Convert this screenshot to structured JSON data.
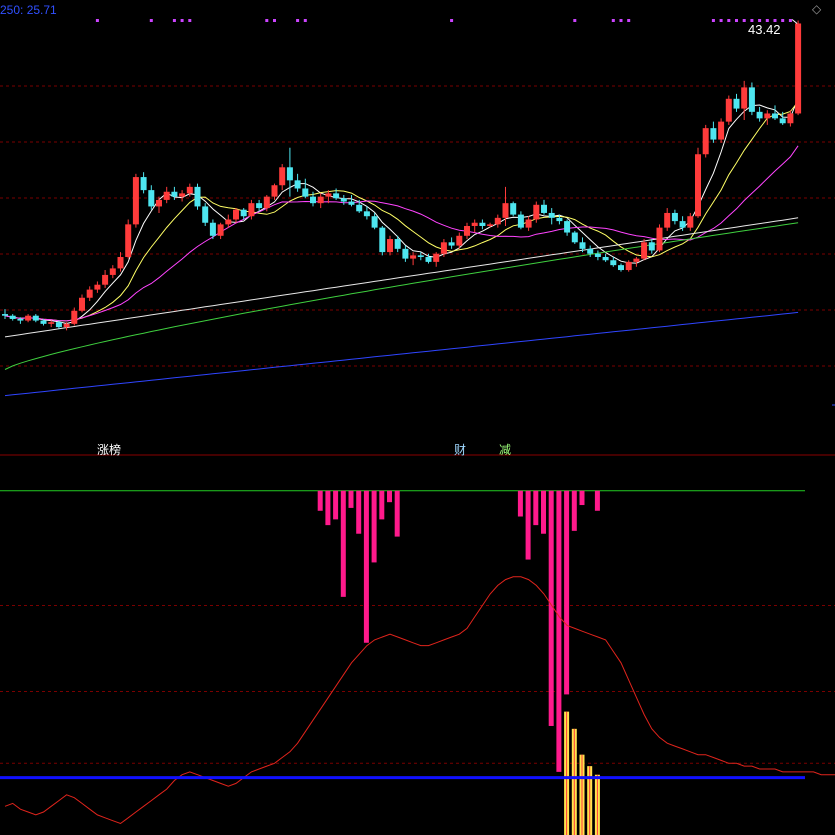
{
  "header": {
    "ma_label": "250: 25.71",
    "last_price": "43.42"
  },
  "signals": {
    "zhangbang": "涨榜",
    "cai": "财",
    "jian": "减"
  },
  "colors": {
    "background": "#000000",
    "up": "#ff3b3b",
    "down": "#4ee6f0",
    "grid": "#7a0000",
    "ma5": "#ffffff",
    "ma10": "#ffff66",
    "ma20": "#ff44ff",
    "ma60": "#3fcf3f",
    "ma120": "#e8e8e8",
    "ma250": "#2f45ff",
    "hist_pink": "#ff1a8c",
    "hist_yellow": "#ffe24d",
    "indicator_line": "#e0241c",
    "zero_line": "#1010ff",
    "upper_line": "#22cc22",
    "markers": "#cc44ff"
  },
  "chart_data": [
    {
      "type": "candlestick",
      "title": "",
      "price_range": [
        18,
        44
      ],
      "last_price": 43.42,
      "bars": [
        [
          25.6,
          25.9,
          25.3,
          25.5
        ],
        [
          25.5,
          25.6,
          25.2,
          25.3
        ],
        [
          25.3,
          25.4,
          25.0,
          25.2
        ],
        [
          25.2,
          25.6,
          25.1,
          25.5
        ],
        [
          25.5,
          25.6,
          25.1,
          25.2
        ],
        [
          25.2,
          25.3,
          24.9,
          25.0
        ],
        [
          25.0,
          25.2,
          24.8,
          25.1
        ],
        [
          25.1,
          25.2,
          24.7,
          24.8
        ],
        [
          24.8,
          25.1,
          24.6,
          25.0
        ],
        [
          25.0,
          26.0,
          24.9,
          25.8
        ],
        [
          25.8,
          26.8,
          25.7,
          26.6
        ],
        [
          26.6,
          27.3,
          26.4,
          27.1
        ],
        [
          27.1,
          27.6,
          26.9,
          27.4
        ],
        [
          27.4,
          28.3,
          27.2,
          28.0
        ],
        [
          28.0,
          28.6,
          27.8,
          28.4
        ],
        [
          28.4,
          29.4,
          28.2,
          29.1
        ],
        [
          29.1,
          31.4,
          29.0,
          31.1
        ],
        [
          31.1,
          34.2,
          30.9,
          34.0
        ],
        [
          34.0,
          34.3,
          33.0,
          33.2
        ],
        [
          33.2,
          33.5,
          32.0,
          32.2
        ],
        [
          32.2,
          32.8,
          31.8,
          32.6
        ],
        [
          32.6,
          33.4,
          32.4,
          33.1
        ],
        [
          33.1,
          33.4,
          32.6,
          32.8
        ],
        [
          32.8,
          33.2,
          32.5,
          33.0
        ],
        [
          33.0,
          33.6,
          32.8,
          33.4
        ],
        [
          33.4,
          33.6,
          32.0,
          32.2
        ],
        [
          32.2,
          32.4,
          31.0,
          31.2
        ],
        [
          31.2,
          31.4,
          30.2,
          30.4
        ],
        [
          30.4,
          31.2,
          30.2,
          31.1
        ],
        [
          31.1,
          31.7,
          30.9,
          31.4
        ],
        [
          31.4,
          32.1,
          31.2,
          32.0
        ],
        [
          32.0,
          32.1,
          31.4,
          31.6
        ],
        [
          31.6,
          32.6,
          31.4,
          32.4
        ],
        [
          32.4,
          32.6,
          31.9,
          32.1
        ],
        [
          32.1,
          32.9,
          31.9,
          32.8
        ],
        [
          32.8,
          33.6,
          32.6,
          33.5
        ],
        [
          33.5,
          34.8,
          33.2,
          34.6
        ],
        [
          34.6,
          35.8,
          32.8,
          33.8
        ],
        [
          33.8,
          34.2,
          33.1,
          33.3
        ],
        [
          33.3,
          33.9,
          32.7,
          32.8
        ],
        [
          32.8,
          33.1,
          32.2,
          32.4
        ],
        [
          32.4,
          33.0,
          32.1,
          32.8
        ],
        [
          32.8,
          33.2,
          32.4,
          33.0
        ],
        [
          33.0,
          33.3,
          32.6,
          32.7
        ],
        [
          32.7,
          32.9,
          32.3,
          32.5
        ],
        [
          32.5,
          32.9,
          32.2,
          32.3
        ],
        [
          32.3,
          32.6,
          31.8,
          31.9
        ],
        [
          31.9,
          32.2,
          31.4,
          31.6
        ],
        [
          31.6,
          31.8,
          30.8,
          30.9
        ],
        [
          30.9,
          31.0,
          29.2,
          29.4
        ],
        [
          29.4,
          30.4,
          29.2,
          30.2
        ],
        [
          30.2,
          30.4,
          29.4,
          29.6
        ],
        [
          29.6,
          29.8,
          28.8,
          29.0
        ],
        [
          29.0,
          29.4,
          28.6,
          29.2
        ],
        [
          29.2,
          29.4,
          28.9,
          29.1
        ],
        [
          29.1,
          29.3,
          28.7,
          28.8
        ],
        [
          28.8,
          29.4,
          28.5,
          29.3
        ],
        [
          29.3,
          30.2,
          29.1,
          30.0
        ],
        [
          30.0,
          30.3,
          29.6,
          29.8
        ],
        [
          29.8,
          30.6,
          29.6,
          30.4
        ],
        [
          30.4,
          31.2,
          30.2,
          31.0
        ],
        [
          31.0,
          31.4,
          30.6,
          31.2
        ],
        [
          31.2,
          31.4,
          30.8,
          31.0
        ],
        [
          31.0,
          31.2,
          30.9,
          31.1
        ],
        [
          31.1,
          31.7,
          30.9,
          31.5
        ],
        [
          31.5,
          33.4,
          31.0,
          32.4
        ],
        [
          32.4,
          32.5,
          31.6,
          31.7
        ],
        [
          31.7,
          31.9,
          30.8,
          30.9
        ],
        [
          30.9,
          31.6,
          30.7,
          31.4
        ],
        [
          31.4,
          32.5,
          31.2,
          32.3
        ],
        [
          32.3,
          32.6,
          31.7,
          31.8
        ],
        [
          31.8,
          32.1,
          31.1,
          31.5
        ],
        [
          31.5,
          31.7,
          31.1,
          31.3
        ],
        [
          31.3,
          31.4,
          30.4,
          30.6
        ],
        [
          30.6,
          30.7,
          29.9,
          30.0
        ],
        [
          30.0,
          30.3,
          29.4,
          29.6
        ],
        [
          29.6,
          29.8,
          29.1,
          29.3
        ],
        [
          29.3,
          29.5,
          28.9,
          29.1
        ],
        [
          29.1,
          29.3,
          28.8,
          28.9
        ],
        [
          28.9,
          29.1,
          28.5,
          28.6
        ],
        [
          28.6,
          28.7,
          28.2,
          28.3
        ],
        [
          28.3,
          28.9,
          28.2,
          28.8
        ],
        [
          28.8,
          29.1,
          28.5,
          29.0
        ],
        [
          29.0,
          30.2,
          28.9,
          30.0
        ],
        [
          30.0,
          30.2,
          29.3,
          29.5
        ],
        [
          29.5,
          31.1,
          29.4,
          30.9
        ],
        [
          30.9,
          32.1,
          30.7,
          31.8
        ],
        [
          31.8,
          32.0,
          31.1,
          31.3
        ],
        [
          31.3,
          31.6,
          30.7,
          30.9
        ],
        [
          30.9,
          31.8,
          30.7,
          31.6
        ],
        [
          31.6,
          35.8,
          31.5,
          35.4
        ],
        [
          35.4,
          37.2,
          35.2,
          37.0
        ],
        [
          37.0,
          37.4,
          36.1,
          36.3
        ],
        [
          36.3,
          37.6,
          36.1,
          37.4
        ],
        [
          37.4,
          39.0,
          37.2,
          38.8
        ],
        [
          38.8,
          39.1,
          38.0,
          38.2
        ],
        [
          38.2,
          39.9,
          37.5,
          39.5
        ],
        [
          39.5,
          39.8,
          37.8,
          38.0
        ],
        [
          38.0,
          38.3,
          37.4,
          37.6
        ],
        [
          37.6,
          38.1,
          37.2,
          37.9
        ],
        [
          37.9,
          38.4,
          37.5,
          37.6
        ],
        [
          37.6,
          38.0,
          37.2,
          37.3
        ],
        [
          37.3,
          38.1,
          37.1,
          37.9
        ],
        [
          37.9,
          43.6,
          37.8,
          43.42
        ]
      ],
      "moving_averages": [
        {
          "period": 5,
          "color": "#ffffff"
        },
        {
          "period": 10,
          "color": "#ffff66"
        },
        {
          "period": 20,
          "color": "#ff44ff"
        },
        {
          "period": 60,
          "color": "#3fcf3f"
        },
        {
          "period": 120,
          "color": "#e8e8e8"
        },
        {
          "period": 250,
          "color": "#2f45ff",
          "value": 25.71
        }
      ],
      "grid": true
    },
    {
      "type": "bar",
      "title": "",
      "y_range": [
        0,
        110
      ],
      "upper_level": 100,
      "zero_level": 0,
      "pink_bars": [
        {
          "index": 41,
          "value": 100,
          "bottom": 93
        },
        {
          "index": 42,
          "value": 100,
          "bottom": 88
        },
        {
          "index": 43,
          "value": 100,
          "bottom": 90
        },
        {
          "index": 44,
          "value": 100,
          "bottom": 63
        },
        {
          "index": 45,
          "value": 100,
          "bottom": 94
        },
        {
          "index": 46,
          "value": 100,
          "bottom": 85
        },
        {
          "index": 47,
          "value": 100,
          "bottom": 47
        },
        {
          "index": 48,
          "value": 100,
          "bottom": 75
        },
        {
          "index": 49,
          "value": 100,
          "bottom": 90
        },
        {
          "index": 50,
          "value": 100,
          "bottom": 96
        },
        {
          "index": 51,
          "value": 100,
          "bottom": 84
        },
        {
          "index": 67,
          "value": 100,
          "bottom": 91
        },
        {
          "index": 68,
          "value": 100,
          "bottom": 76
        },
        {
          "index": 69,
          "value": 100,
          "bottom": 88
        },
        {
          "index": 70,
          "value": 100,
          "bottom": 85
        },
        {
          "index": 71,
          "value": 100,
          "bottom": 18
        },
        {
          "index": 72,
          "value": 100,
          "bottom": 2
        },
        {
          "index": 73,
          "value": 100,
          "bottom": 29
        },
        {
          "index": 74,
          "value": 100,
          "bottom": 86
        },
        {
          "index": 75,
          "value": 100,
          "bottom": 95
        },
        {
          "index": 77,
          "value": 100,
          "bottom": 93
        }
      ],
      "yellow_bars": [
        {
          "index": 73,
          "value": 23
        },
        {
          "index": 74,
          "value": 17
        },
        {
          "index": 75,
          "value": 8
        },
        {
          "index": 76,
          "value": 4
        },
        {
          "index": 77,
          "value": 1
        }
      ],
      "line": [
        -10,
        -9,
        -11,
        -12,
        -13,
        -12,
        -10,
        -8,
        -6,
        -7,
        -9,
        -11,
        -13,
        -14,
        -15,
        -16,
        -14,
        -12,
        -10,
        -8,
        -6,
        -4,
        -1,
        1,
        2,
        1,
        0,
        -1,
        -2,
        -3,
        -2,
        0,
        2,
        3,
        4,
        5,
        7,
        9,
        12,
        16,
        20,
        24,
        28,
        32,
        36,
        40,
        43,
        46,
        48,
        49,
        50,
        49,
        48,
        47,
        46,
        46,
        47,
        48,
        49,
        50,
        52,
        56,
        60,
        64,
        67,
        69,
        70,
        70,
        69,
        67,
        64,
        60,
        56,
        53,
        52,
        51,
        50,
        49,
        48,
        44,
        40,
        34,
        28,
        22,
        17,
        14,
        12,
        11,
        10,
        9,
        8,
        8,
        7,
        6,
        5,
        5,
        4,
        4,
        3,
        3,
        3,
        2,
        2,
        2,
        2,
        2,
        1,
        1,
        1,
        1
      ],
      "grid": true
    }
  ]
}
